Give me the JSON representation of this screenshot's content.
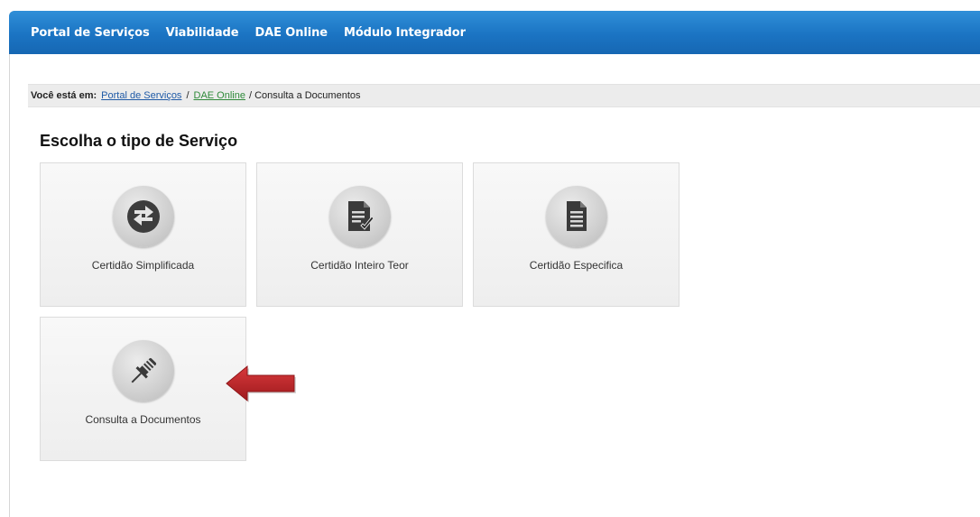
{
  "nav": {
    "items": [
      "Portal de Serviços",
      "Viabilidade",
      "DAE Online",
      "Módulo Integrador"
    ]
  },
  "breadcrumb": {
    "label": "Você está em:",
    "link1": "Portal de Serviços",
    "sep": "/",
    "link2": "DAE Online",
    "current": "/ Consulta a Documentos"
  },
  "page": {
    "title": "Escolha o tipo de Serviço"
  },
  "services": [
    {
      "label": "Certidão Simplificada",
      "icon": "refresh-icon"
    },
    {
      "label": "Certidão Inteiro Teor",
      "icon": "document-check-icon"
    },
    {
      "label": "Certidão Especifica",
      "icon": "document-icon"
    },
    {
      "label": "Consulta a Documentos",
      "icon": "pin-icon"
    }
  ],
  "colors": {
    "navbar": "#1b74c3",
    "arrow": "#c0262a"
  }
}
